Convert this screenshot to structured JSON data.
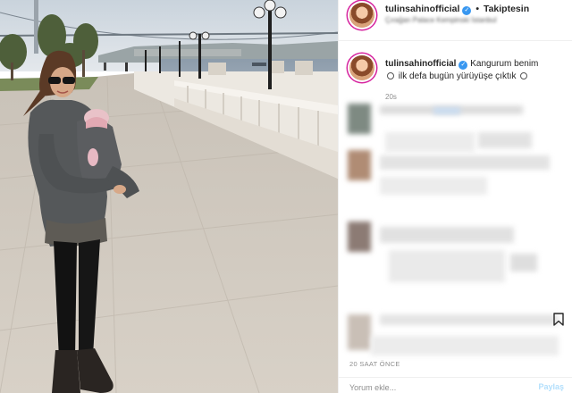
{
  "post": {
    "username": "tulinsahinofficial",
    "follow_label": "Takiptesin",
    "location": "Çırağan Palace Kempinski İstanbul",
    "caption_line1": "Kangurum benim",
    "caption_line2": "ilk defa bugün yürüyüşe çıktık",
    "caption_age": "20s",
    "timestamp": "20 SAAT ÖNCE"
  },
  "comment": {
    "placeholder": "Yorum ekle...",
    "share_label": "Paylaş"
  },
  "colors": {
    "verified": "#3897f0",
    "story_ring": "#d6249f",
    "share_disabled": "#b2dffc"
  },
  "icons": {
    "verified": "verified-badge-icon",
    "bookmark": "bookmark-icon",
    "emoji": "smile-emoji-icon"
  }
}
